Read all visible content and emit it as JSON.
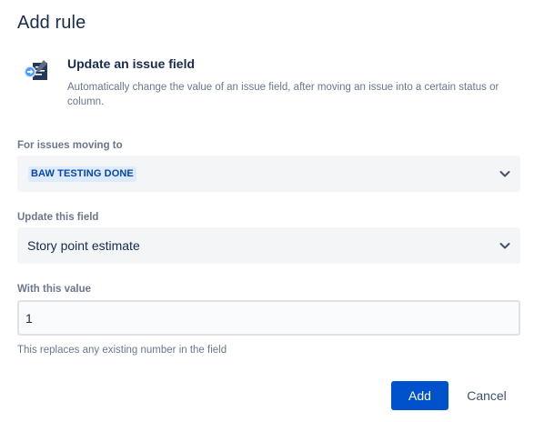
{
  "dialog": {
    "title": "Add rule"
  },
  "rule": {
    "icon": "update-field-icon",
    "heading": "Update an issue field",
    "description": "Automatically change the value of an issue field, after moving an issue into a certain status or column."
  },
  "fields": {
    "moving_to": {
      "label": "For issues moving to",
      "value": "BAW TESTING DONE"
    },
    "update_field": {
      "label": "Update this field",
      "value": "Story point estimate"
    },
    "with_value": {
      "label": "With this value",
      "value": "1",
      "helper": "This replaces any existing number in the field"
    }
  },
  "buttons": {
    "add_label": "Add",
    "cancel_label": "Cancel"
  },
  "colors": {
    "primary": "#0052cc",
    "lozenge_bg": "#deebff",
    "lozenge_text": "#0747a6",
    "select_bg": "#f4f5f7",
    "muted_text": "#6b778c"
  }
}
